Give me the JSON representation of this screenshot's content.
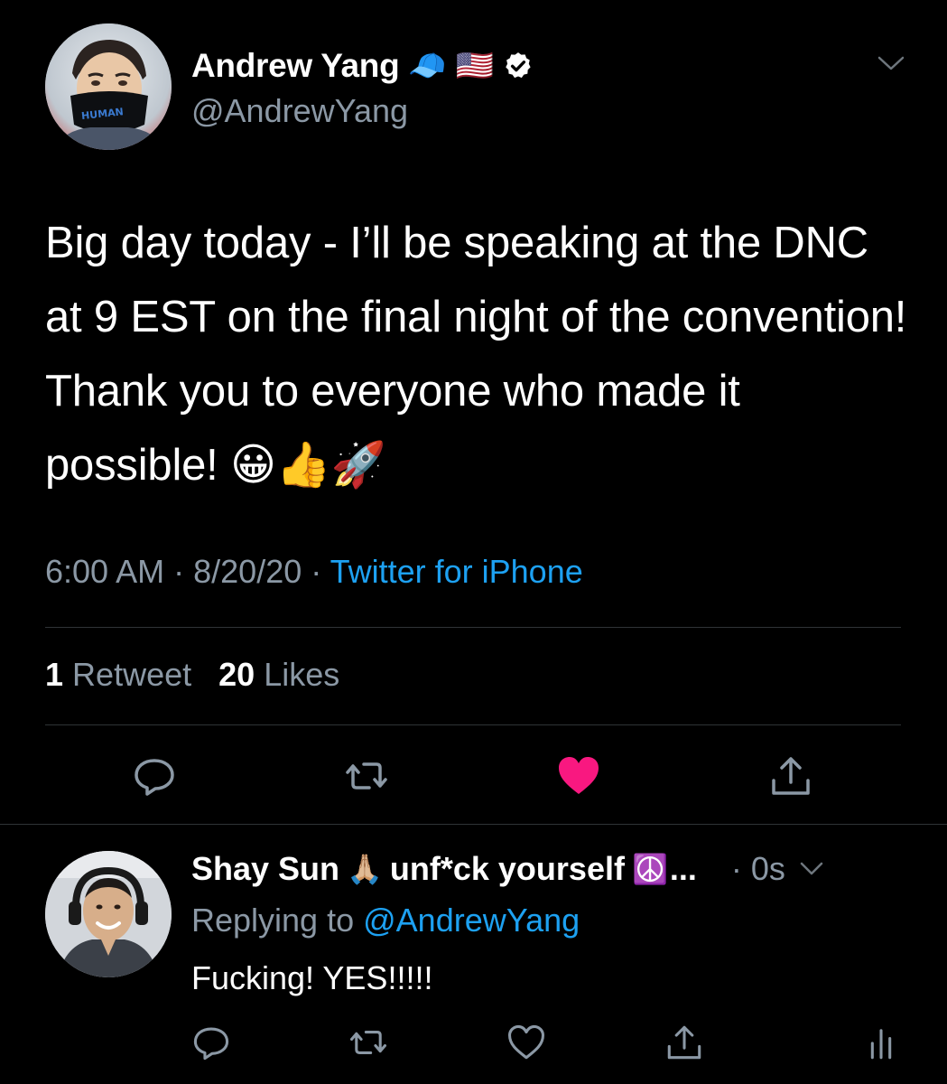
{
  "tweet": {
    "author_name": "Andrew Yang",
    "author_emojis": [
      "🧢",
      "🇺🇸"
    ],
    "verified_icon": "verified-badge-icon",
    "handle": "@AndrewYang",
    "avatar_mask_text": "HUMAN",
    "text": "Big day today - I’ll be speaking at the DNC at 9 EST on the final night of the convention!  Thank you to everyone who made it possible!  😀👍🚀",
    "time": "6:00 AM",
    "date": "8/20/20",
    "source": "Twitter for iPhone",
    "separator": "·",
    "retweet_count": "1",
    "retweet_label": "Retweet",
    "like_count": "20",
    "like_label": "Likes",
    "liked": true
  },
  "reply": {
    "author_name": "Shay Sun",
    "name_emoji_1": "🙏🏼",
    "name_suffix": "unf*ck yourself",
    "name_emoji_2": "☮️",
    "ellipsis": "...",
    "time": "· 0s",
    "replying_prefix": "Replying to",
    "replying_handle": "@AndrewYang",
    "text": "Fucking! YES!!!!!"
  },
  "colors": {
    "background": "#000000",
    "text": "#ffffff",
    "secondary": "#8b98a5",
    "link": "#1da1f2",
    "like": "#f91880",
    "divider": "#2f3336"
  }
}
